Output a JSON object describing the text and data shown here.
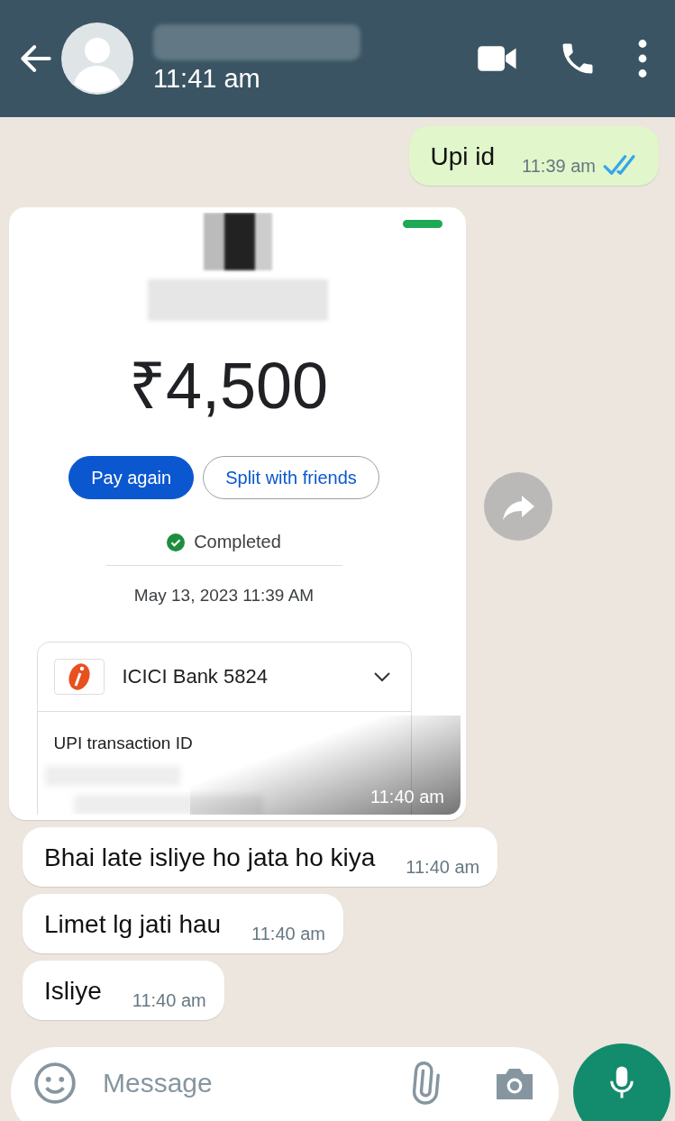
{
  "header": {
    "status": "11:41 am"
  },
  "messages": [
    {
      "kind": "text",
      "outgoing": true,
      "text": "Upi id",
      "time": "11:39 am",
      "read": true
    },
    {
      "kind": "payment",
      "outgoing": false,
      "time": "11:40 am",
      "payment": {
        "amount": "₹4,500",
        "buttons": [
          {
            "label": "Pay again",
            "primary": true
          },
          {
            "label": "Split with friends",
            "primary": false
          }
        ],
        "status": "Completed",
        "date": "May 13, 2023 11:39 AM",
        "bank": "ICICI Bank 5824",
        "detail_label": "UPI transaction ID"
      }
    },
    {
      "kind": "text",
      "outgoing": false,
      "text": "Bhai late isliye ho jata ho kiya",
      "time": "11:40 am"
    },
    {
      "kind": "text",
      "outgoing": false,
      "text": "Limet lg jati hau",
      "time": "11:40 am"
    },
    {
      "kind": "text",
      "outgoing": false,
      "text": "Isliye",
      "time": "11:40 am"
    }
  ],
  "composer": {
    "placeholder": "Message"
  }
}
